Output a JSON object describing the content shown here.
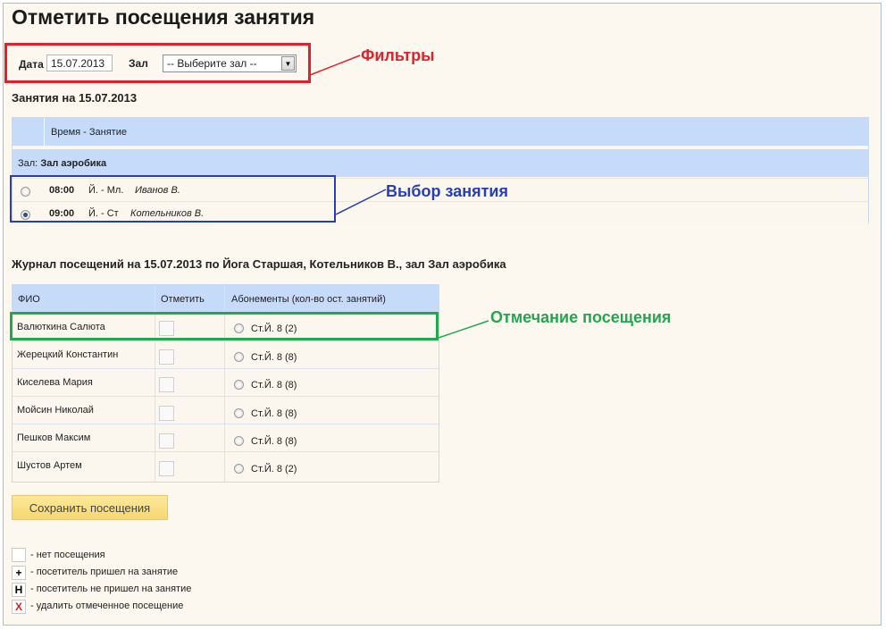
{
  "page_title": "Отметить посещения занятия",
  "filters": {
    "date_label": "Дата",
    "date_value": "15.07.2013",
    "hall_label": "Зал",
    "hall_selected": "-- Выберите зал --"
  },
  "annotations": {
    "filters": "Фильтры",
    "lesson_choice": "Выбор занятия",
    "attendance_marking": "Отмечание посещения",
    "colors": {
      "red": "#e3202a",
      "blue": "#283fb3",
      "green": "#23a650"
    }
  },
  "lessons": {
    "title": "Занятия на 15.07.2013",
    "header": "Время - Занятие",
    "group_prefix": "Зал:",
    "group_name": "Зал аэробика",
    "rows": [
      {
        "time": "08:00",
        "lesson": "Й. - Мл.",
        "trainer": "Иванов В.",
        "selected": false
      },
      {
        "time": "09:00",
        "lesson": "Й. - Ст",
        "trainer": "Котельников В.",
        "selected": true
      }
    ]
  },
  "journal": {
    "title": "Журнал посещений на 15.07.2013 по Йога Старшая, Котельников В., зал Зал аэробика",
    "columns": [
      "ФИО",
      "Отметить",
      "Абонементы (кол-во ост. занятий)"
    ],
    "rows": [
      {
        "name": "Валюткина Салюта",
        "subscription": "Ст.Й. 8 (2)"
      },
      {
        "name": "Жерецкий Константин",
        "subscription": "Ст.Й. 8 (8)"
      },
      {
        "name": "Киселева Мария",
        "subscription": "Ст.Й. 8 (8)"
      },
      {
        "name": "Мойсин Николай",
        "subscription": "Ст.Й. 8 (8)"
      },
      {
        "name": "Пешков Максим",
        "subscription": "Ст.Й. 8 (8)"
      },
      {
        "name": "Шустов Артем",
        "subscription": "Ст.Й. 8 (2)"
      }
    ]
  },
  "save_button": "Сохранить посещения",
  "legend": [
    {
      "icon": "",
      "text": "- нет посещения"
    },
    {
      "icon": "+",
      "text": "- посетитель пришел на занятие"
    },
    {
      "icon": "Н",
      "text": "- посетитель не пришел на занятие"
    },
    {
      "icon": "X",
      "text": "- удалить отмеченное посещение"
    }
  ]
}
